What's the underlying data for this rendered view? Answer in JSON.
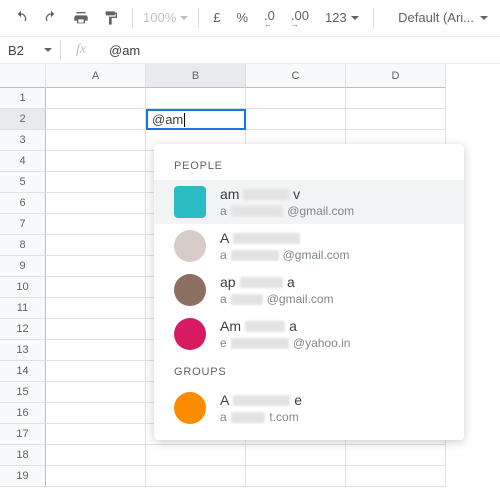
{
  "toolbar": {
    "zoom": "100%",
    "currency": "£",
    "percent": "%",
    "decDec": ".0",
    "incDec": ".00",
    "format": "123",
    "font": "Default (Ari..."
  },
  "formula": {
    "cellRef": "B2",
    "fxLabel": "fx",
    "value": "@am"
  },
  "columns": [
    "A",
    "B",
    "C",
    "D"
  ],
  "activeCol": "B",
  "activeRow": 2,
  "rowCount": 19,
  "activeCell": {
    "text": "@am"
  },
  "dropdown": {
    "peopleHeader": "PEOPLE",
    "groupsHeader": "GROUPS",
    "people": [
      {
        "name": "am",
        "nameTail": "v",
        "emailPre": "a",
        "emailSuffix": "@gmail.com",
        "avatar": "#2bbcc4",
        "square": true,
        "hl": true
      },
      {
        "name": "A",
        "nameTail": "",
        "emailPre": "a",
        "emailSuffix": "@gmail.com",
        "avatar": "#d7ccc8",
        "square": false,
        "hl": false
      },
      {
        "name": "ap",
        "nameTail": "a",
        "emailPre": "a",
        "emailSuffix": "@gmail.com",
        "avatar": "#8d6e63",
        "square": false,
        "hl": false
      },
      {
        "name": "Am",
        "nameTail": "a",
        "emailPre": "e",
        "emailSuffix": "@yahoo.in",
        "avatar": "#d81b60",
        "square": false,
        "hl": false
      }
    ],
    "groups": [
      {
        "name": "A",
        "nameTail": "e",
        "emailPre": "a",
        "emailSuffix": "t.com",
        "avatar": "#fb8c00",
        "square": false
      }
    ]
  }
}
